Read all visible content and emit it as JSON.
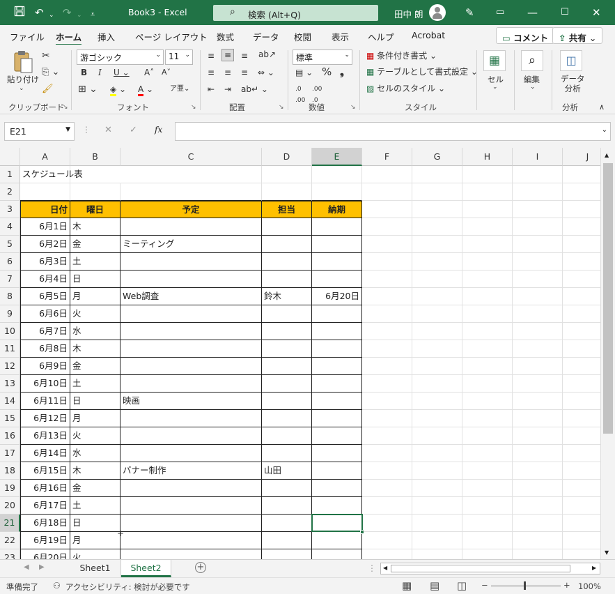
{
  "window": {
    "title": "Book3 - Excel",
    "search_placeholder": "検索 (Alt+Q)",
    "user_name": "田中 朗"
  },
  "menu": {
    "tabs": [
      "ファイル",
      "ホーム",
      "挿入",
      "ページ レイアウト",
      "数式",
      "データ",
      "校閲",
      "表示",
      "ヘルプ",
      "Acrobat"
    ],
    "active_tab": "ホーム",
    "comment_label": "コメント",
    "share_label": "共有"
  },
  "ribbon": {
    "clipboard": {
      "paste_label": "貼り付け",
      "group_label": "クリップボード"
    },
    "font": {
      "font_name": "游ゴシック",
      "font_size": "11",
      "group_label": "フォント"
    },
    "alignment": {
      "group_label": "配置"
    },
    "number": {
      "format": "標準",
      "group_label": "数値"
    },
    "styles": {
      "conditional": "条件付き書式",
      "table": "テーブルとして書式設定",
      "cell_style": "セルのスタイル",
      "group_label": "スタイル"
    },
    "cells": {
      "label": "セル"
    },
    "editing": {
      "label": "編集"
    },
    "analysis": {
      "label_line1": "データ",
      "label_line2": "分析",
      "group_label": "分析"
    }
  },
  "formula_bar": {
    "name_box": "E21",
    "fx": "fx",
    "formula": ""
  },
  "sheet": {
    "columns": [
      "A",
      "B",
      "C",
      "D",
      "E",
      "F",
      "G",
      "H",
      "I",
      "J"
    ],
    "selected_column": "E",
    "selected_row": "21",
    "title_cell": "スケジュール表",
    "header": [
      "日付",
      "曜日",
      "予定",
      "担当",
      "納期"
    ],
    "rows": [
      {
        "num": "4",
        "date": "6月1日",
        "day": "木",
        "plan": "",
        "person": "",
        "due": ""
      },
      {
        "num": "5",
        "date": "6月2日",
        "day": "金",
        "plan": "ミーティング",
        "person": "",
        "due": ""
      },
      {
        "num": "6",
        "date": "6月3日",
        "day": "土",
        "plan": "",
        "person": "",
        "due": ""
      },
      {
        "num": "7",
        "date": "6月4日",
        "day": "日",
        "plan": "",
        "person": "",
        "due": ""
      },
      {
        "num": "8",
        "date": "6月5日",
        "day": "月",
        "plan": "Web調査",
        "person": "鈴木",
        "due": "6月20日"
      },
      {
        "num": "9",
        "date": "6月6日",
        "day": "火",
        "plan": "",
        "person": "",
        "due": ""
      },
      {
        "num": "10",
        "date": "6月7日",
        "day": "水",
        "plan": "",
        "person": "",
        "due": ""
      },
      {
        "num": "11",
        "date": "6月8日",
        "day": "木",
        "plan": "",
        "person": "",
        "due": ""
      },
      {
        "num": "12",
        "date": "6月9日",
        "day": "金",
        "plan": "",
        "person": "",
        "due": ""
      },
      {
        "num": "13",
        "date": "6月10日",
        "day": "土",
        "plan": "",
        "person": "",
        "due": ""
      },
      {
        "num": "14",
        "date": "6月11日",
        "day": "日",
        "plan": "映画",
        "person": "",
        "due": ""
      },
      {
        "num": "15",
        "date": "6月12日",
        "day": "月",
        "plan": "",
        "person": "",
        "due": ""
      },
      {
        "num": "16",
        "date": "6月13日",
        "day": "火",
        "plan": "",
        "person": "",
        "due": ""
      },
      {
        "num": "17",
        "date": "6月14日",
        "day": "水",
        "plan": "",
        "person": "",
        "due": ""
      },
      {
        "num": "18",
        "date": "6月15日",
        "day": "木",
        "plan": "バナー制作",
        "person": "山田",
        "due": ""
      },
      {
        "num": "19",
        "date": "6月16日",
        "day": "金",
        "plan": "",
        "person": "",
        "due": ""
      },
      {
        "num": "20",
        "date": "6月17日",
        "day": "土",
        "plan": "",
        "person": "",
        "due": ""
      },
      {
        "num": "21",
        "date": "6月18日",
        "day": "日",
        "plan": "",
        "person": "",
        "due": ""
      },
      {
        "num": "22",
        "date": "6月19日",
        "day": "月",
        "plan": "",
        "person": "",
        "due": ""
      },
      {
        "num": "23",
        "date": "6月20日",
        "day": "火",
        "plan": "",
        "person": "",
        "due": ""
      }
    ]
  },
  "sheet_tabs": {
    "tabs": [
      "Sheet1",
      "Sheet2"
    ],
    "active": "Sheet2"
  },
  "status": {
    "ready": "準備完了",
    "accessibility": "アクセシビリティ: 検討が必要です",
    "zoom": "100%"
  },
  "colors": {
    "accent": "#217346",
    "header_fill": "#ffc000"
  }
}
